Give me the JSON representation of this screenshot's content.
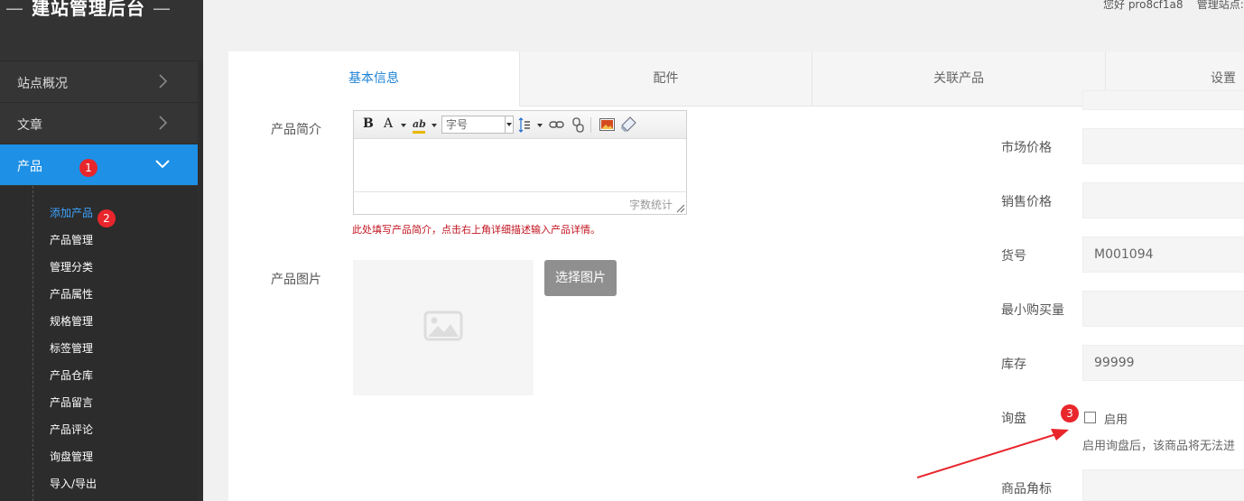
{
  "app": {
    "title": "建站管理后台",
    "title_left": "—",
    "title_right": "—",
    "user_greeting": "您好 pro8cf1a8",
    "site_label": "管理站点:"
  },
  "sidebar": {
    "items": [
      {
        "label": "站点概况",
        "icon": "chevron-right-icon"
      },
      {
        "label": "文章",
        "icon": "chevron-right-icon"
      },
      {
        "label": "产品",
        "icon": "chevron-down-icon",
        "active": true,
        "badge": "1"
      }
    ],
    "submenu": [
      {
        "label": "添加产品",
        "active": true,
        "badge": "2"
      },
      {
        "label": "产品管理"
      },
      {
        "label": "管理分类"
      },
      {
        "label": "产品属性"
      },
      {
        "label": "规格管理"
      },
      {
        "label": "标签管理"
      },
      {
        "label": "产品仓库"
      },
      {
        "label": "产品留言"
      },
      {
        "label": "产品评论"
      },
      {
        "label": "询盘管理"
      },
      {
        "label": "导入/导出"
      }
    ]
  },
  "tabs": [
    {
      "label": "基本信息",
      "active": true
    },
    {
      "label": "配件"
    },
    {
      "label": "关联产品"
    },
    {
      "label": "设置"
    }
  ],
  "form": {
    "summary_label": "产品简介",
    "editor": {
      "bold": "B",
      "font_color": "A",
      "highlight": "ab",
      "font_size_placeholder": "字号",
      "word_count": "字数统计"
    },
    "summary_hint": "此处填写产品简介，点击右上角详细描述输入产品详情。",
    "image_label": "产品图片",
    "choose_image_button": "选择图片",
    "market_price_label": "市场价格",
    "market_price_value": "",
    "sale_price_label": "销售价格",
    "sale_price_value": "",
    "sku_label": "货号",
    "sku_value": "M001094",
    "min_qty_label": "最小购买量",
    "min_qty_value": "",
    "stock_label": "库存",
    "stock_value": "99999",
    "inquiry_label": "询盘",
    "inquiry_checkbox_label": "启用",
    "inquiry_checked": false,
    "inquiry_hint": "启用询盘后，该商品将无法进",
    "corner_label": "商品角标",
    "step3_badge": "3"
  },
  "colors": {
    "sidebar_bg": "#353535",
    "active_blue": "#1e90e6",
    "badge_red": "#e8262c",
    "hint_red": "#c1131f"
  }
}
